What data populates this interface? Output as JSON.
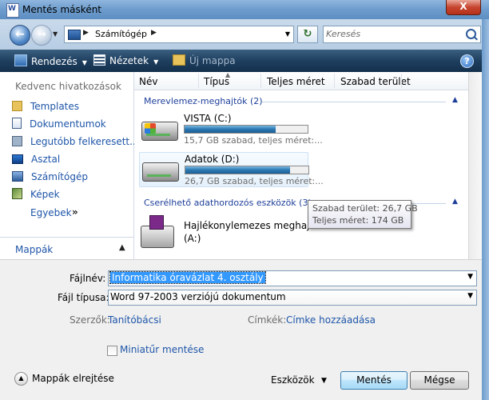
{
  "window": {
    "title": "Mentés másként",
    "close_label": "X"
  },
  "address_bar": {
    "location": "Számítógép",
    "search_placeholder": "Keresés"
  },
  "toolbar": {
    "organize": "Rendezés",
    "views": "Nézetek",
    "new_folder": "Új mappa",
    "help": "?"
  },
  "favorites": {
    "header": "Kedvenc hivatkozások",
    "items": [
      {
        "label": "Templates",
        "icon": "folder-icon"
      },
      {
        "label": "Dokumentumok",
        "icon": "documents-icon"
      },
      {
        "label": "Legutóbb felkeresett...",
        "icon": "recent-icon"
      },
      {
        "label": "Asztal",
        "icon": "desktop-icon"
      },
      {
        "label": "Számítógép",
        "icon": "computer-icon"
      },
      {
        "label": "Képek",
        "icon": "pictures-icon"
      }
    ],
    "more": "Egyebek",
    "more_arrow": "»"
  },
  "folders_bar": {
    "label": "Mappák"
  },
  "columns": [
    "Név",
    "Típus",
    "Teljes méret",
    "Szabad terület"
  ],
  "groups": {
    "hdd": "Merevlemez-meghajtók (2)",
    "removable": "Cserélhető adathordozós eszközök (3)"
  },
  "drives": [
    {
      "name": "VISTA (C:)",
      "info": "15,7 GB szabad, teljes méret:...",
      "used_fraction": 0.74
    },
    {
      "name": "Adatok (D:)",
      "info": "26,7 GB szabad, teljes méret:...",
      "used_fraction": 0.85
    }
  ],
  "floppy": {
    "name_line1": "Hajlékonylemezes meghajtó",
    "name_line2": "(A:)"
  },
  "tooltip": {
    "free": "Szabad terület: 26,7 GB",
    "total": "Teljes méret: 174 GB"
  },
  "form": {
    "filename_label": "Fájlnév:",
    "filename_value": "Informatika óravázlat 4. osztály",
    "filetype_label": "Fájl típusa:",
    "filetype_value": "Word 97-2003 verziójú dokumentum",
    "authors_label": "Szerzők:",
    "authors_value": "Tanítóbácsi",
    "tags_label": "Címkék:",
    "tags_value": "Címke hozzáadása",
    "thumbnail_label": "Miniatűr mentése"
  },
  "footer": {
    "hide_folders": "Mappák elrejtése",
    "tools": "Eszközök",
    "save": "Mentés",
    "cancel": "Mégse"
  },
  "colors": {
    "link": "#1e55a8",
    "group": "#1e3f9a",
    "toolbar": "#1f3f5f"
  }
}
